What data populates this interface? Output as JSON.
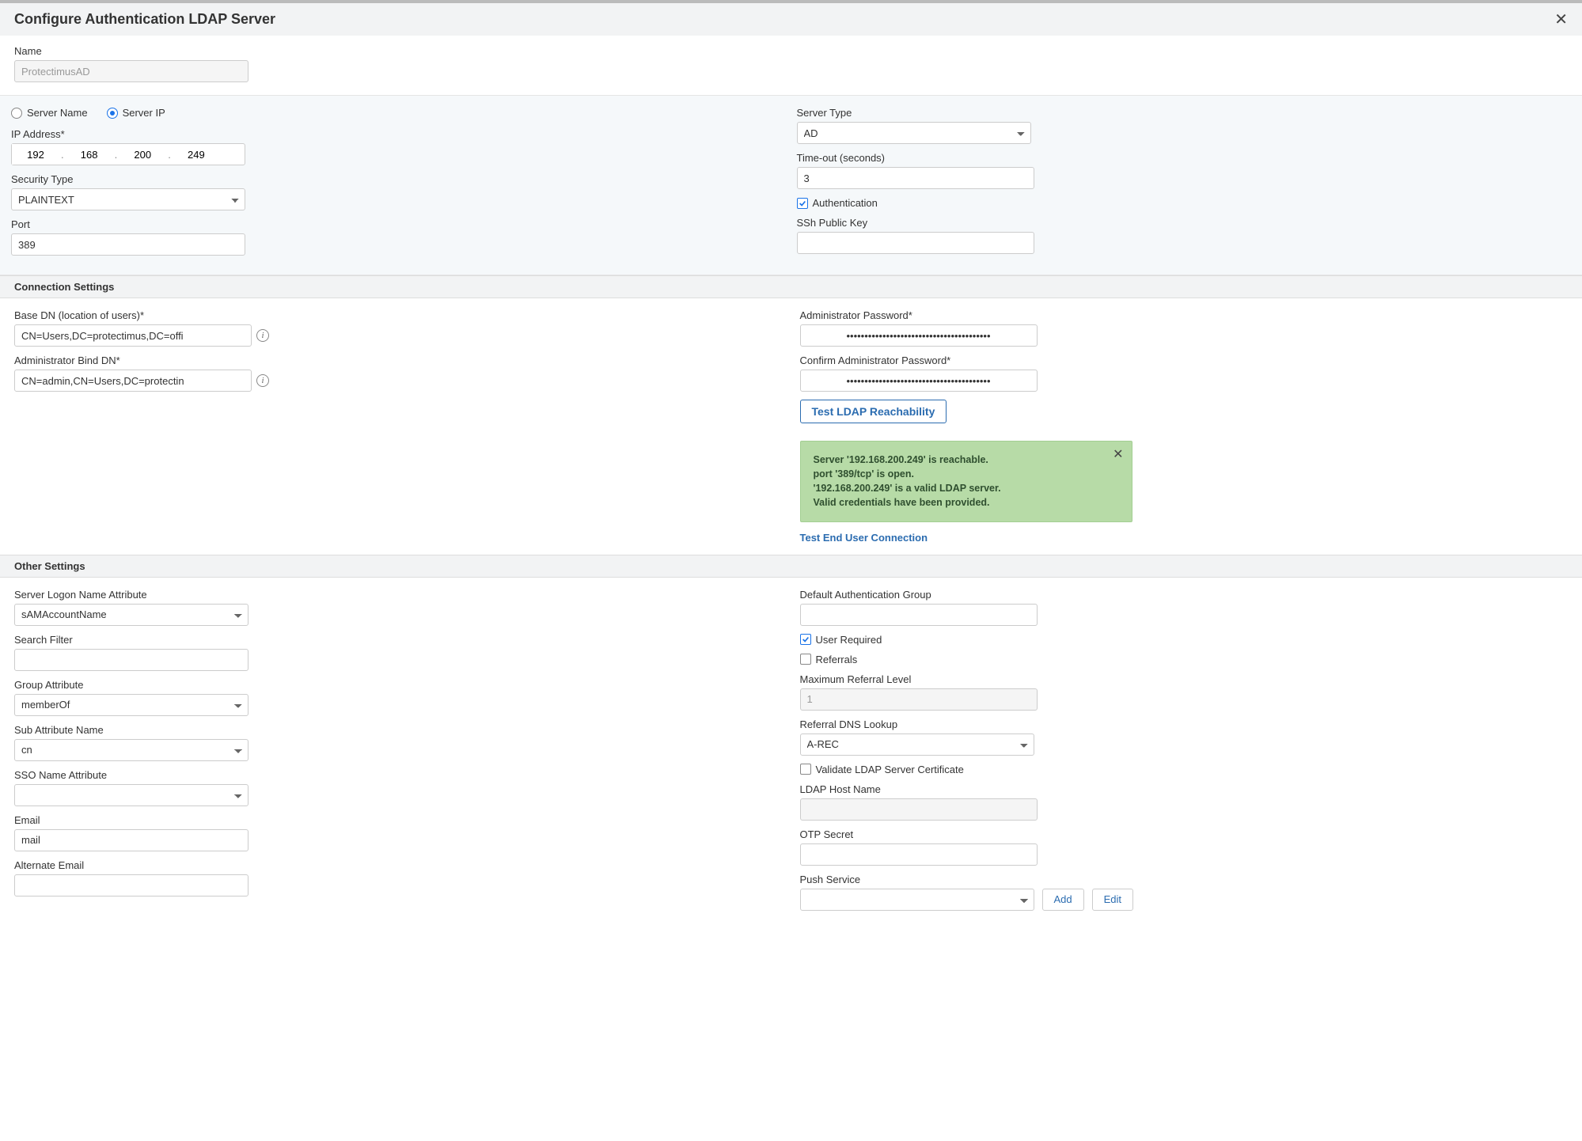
{
  "header": {
    "title": "Configure Authentication LDAP Server"
  },
  "name": {
    "label": "Name",
    "value": "ProtectimusAD"
  },
  "addrMode": {
    "serverNameLabel": "Server Name",
    "serverIPLabel": "Server IP",
    "selected": "ip"
  },
  "ip": {
    "label": "IP Address*",
    "oct1": "192",
    "oct2": "168",
    "oct3": "200",
    "oct4": "249"
  },
  "securityType": {
    "label": "Security Type",
    "value": "PLAINTEXT"
  },
  "port": {
    "label": "Port",
    "value": "389"
  },
  "serverType": {
    "label": "Server Type",
    "value": "AD"
  },
  "timeout": {
    "label": "Time-out (seconds)",
    "value": "3"
  },
  "authentication": {
    "label": "Authentication",
    "checked": true
  },
  "sshKey": {
    "label": "SSh Public Key",
    "value": ""
  },
  "sectionConnection": "Connection Settings",
  "baseDN": {
    "label": "Base DN (location of users)*",
    "value": "CN=Users,DC=protectimus,DC=offi"
  },
  "bindDN": {
    "label": "Administrator Bind DN*",
    "value": "CN=admin,CN=Users,DC=protectin"
  },
  "adminPwd": {
    "label": "Administrator Password*",
    "value": "••••••••••••••••••••••••••••••••••••••••"
  },
  "confirmPwd": {
    "label": "Confirm Administrator Password*",
    "value": "••••••••••••••••••••••••••••••••••••••••"
  },
  "testReachBtn": "Test LDAP Reachability",
  "status": {
    "line1": "Server '192.168.200.249' is reachable.",
    "line2": "port '389/tcp' is open.",
    "line3": "'192.168.200.249' is a valid LDAP server.",
    "line4": "Valid credentials have been provided."
  },
  "testEndUser": "Test End User Connection",
  "sectionOther": "Other Settings",
  "logonAttr": {
    "label": "Server Logon Name Attribute",
    "value": "sAMAccountName"
  },
  "searchFilter": {
    "label": "Search Filter",
    "value": ""
  },
  "groupAttr": {
    "label": "Group Attribute",
    "value": "memberOf"
  },
  "subAttr": {
    "label": "Sub Attribute Name",
    "value": "cn"
  },
  "ssoAttr": {
    "label": "SSO Name Attribute",
    "value": ""
  },
  "email": {
    "label": "Email",
    "value": "mail"
  },
  "altEmail": {
    "label": "Alternate Email",
    "value": ""
  },
  "defaultAuthGroup": {
    "label": "Default Authentication Group",
    "value": ""
  },
  "userRequired": {
    "label": "User Required",
    "checked": true
  },
  "referrals": {
    "label": "Referrals",
    "checked": false
  },
  "maxReferral": {
    "label": "Maximum Referral Level",
    "value": "1"
  },
  "referralDNS": {
    "label": "Referral DNS Lookup",
    "value": "A-REC"
  },
  "validateCert": {
    "label": "Validate LDAP Server Certificate",
    "checked": false
  },
  "ldapHost": {
    "label": "LDAP Host Name",
    "value": ""
  },
  "otpSecret": {
    "label": "OTP Secret",
    "value": ""
  },
  "pushService": {
    "label": "Push Service",
    "value": "",
    "addBtn": "Add",
    "editBtn": "Edit"
  }
}
